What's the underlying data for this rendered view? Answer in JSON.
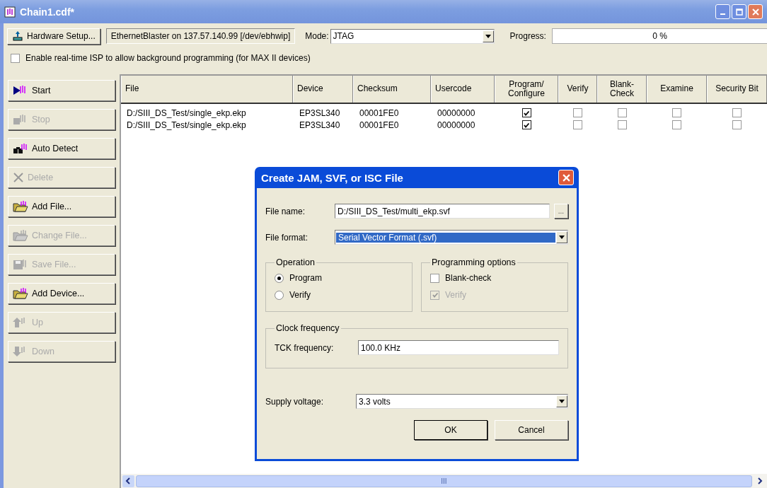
{
  "window": {
    "title": "Chain1.cdf*"
  },
  "toolbar": {
    "hardware_button": "Hardware Setup...",
    "hardware_label": "EthernetBlaster on 137.57.140.99 [/dev/ebhwip]",
    "mode_label": "Mode:",
    "mode_value": "JTAG",
    "progress_label": "Progress:",
    "progress_value": "0 %"
  },
  "isp_option": {
    "label": "Enable real-time ISP to allow background programming (for MAX II devices)",
    "checked": false
  },
  "side_buttons": [
    {
      "label": "Start",
      "kind": "start",
      "disabled": false
    },
    {
      "label": "Stop",
      "kind": "stop",
      "disabled": true
    },
    {
      "label": "Auto Detect",
      "kind": "detect",
      "disabled": false
    },
    {
      "label": "Delete",
      "kind": "delete",
      "disabled": true
    },
    {
      "label": "Add File...",
      "kind": "folder",
      "disabled": false
    },
    {
      "label": "Change File...",
      "kind": "folder",
      "disabled": true
    },
    {
      "label": "Save File...",
      "kind": "save",
      "disabled": true
    },
    {
      "label": "Add Device...",
      "kind": "folder",
      "disabled": false
    },
    {
      "label": "Up",
      "kind": "up",
      "disabled": true
    },
    {
      "label": "Down",
      "kind": "down",
      "disabled": true
    }
  ],
  "table": {
    "columns": [
      {
        "label": "File",
        "kind": "text"
      },
      {
        "label": "Device",
        "kind": "text"
      },
      {
        "label": "Checksum",
        "kind": "text"
      },
      {
        "label": "Usercode",
        "kind": "text"
      },
      {
        "label": "Program/ Configure",
        "kind": "check"
      },
      {
        "label": "Verify",
        "kind": "check"
      },
      {
        "label": "Blank- Check",
        "kind": "check"
      },
      {
        "label": "Examine",
        "kind": "check"
      },
      {
        "label": "Security Bit",
        "kind": "check"
      }
    ],
    "rows": [
      {
        "cells": [
          "D:/SIII_DS_Test/single_ekp.ekp",
          "EP3SL340",
          "00001FE0",
          "00000000"
        ],
        "checks": [
          true,
          false,
          false,
          false,
          false
        ]
      },
      {
        "cells": [
          "D:/SIII_DS_Test/single_ekp.ekp",
          "EP3SL340",
          "00001FE0",
          "00000000"
        ],
        "checks": [
          true,
          false,
          false,
          false,
          false
        ]
      }
    ]
  },
  "dialog": {
    "title": "Create JAM, SVF, or ISC File",
    "file_name_label": "File name:",
    "file_name_value": "D:/SIII_DS_Test/multi_ekp.svf",
    "browse_button": "...",
    "file_format_label": "File format:",
    "file_format_value": "Serial Vector Format (.svf)",
    "operation": {
      "title": "Operation",
      "options": [
        {
          "label": "Program",
          "selected": true
        },
        {
          "label": "Verify",
          "selected": false
        }
      ]
    },
    "programming_options": {
      "title": "Programming options",
      "options": [
        {
          "label": "Blank-check",
          "checked": false,
          "disabled": false
        },
        {
          "label": "Verify",
          "checked": true,
          "disabled": true
        }
      ]
    },
    "clock": {
      "title": "Clock frequency",
      "label": "TCK frequency:",
      "value": "100.0 KHz"
    },
    "supply_label": "Supply voltage:",
    "supply_value": "3.3 volts",
    "buttons": [
      "OK",
      "Cancel"
    ]
  },
  "scrollbar_grip": "III"
}
